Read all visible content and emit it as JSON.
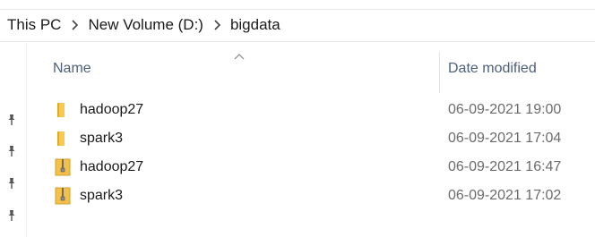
{
  "breadcrumb": [
    "This PC",
    "New Volume (D:)",
    "bigdata"
  ],
  "columns": {
    "name": "Name",
    "date_modified": "Date modified"
  },
  "files": [
    {
      "name": "hadoop27",
      "type": "folder",
      "date": "06-09-2021 19:00"
    },
    {
      "name": "spark3",
      "type": "folder",
      "date": "06-09-2021 17:04"
    },
    {
      "name": "hadoop27",
      "type": "zip",
      "date": "06-09-2021 16:47"
    },
    {
      "name": "spark3",
      "type": "zip",
      "date": "06-09-2021 17:02"
    }
  ],
  "colors": {
    "folder": "#f8c94f",
    "folder_dark": "#e0a72c",
    "zip_body": "#f3c14a",
    "zipper": "#6b6b6b",
    "header_text": "#4c607a"
  },
  "icons": {
    "separator": "chevron-right-icon",
    "pin": "pin-icon",
    "sort": "sort-ascending-icon"
  }
}
